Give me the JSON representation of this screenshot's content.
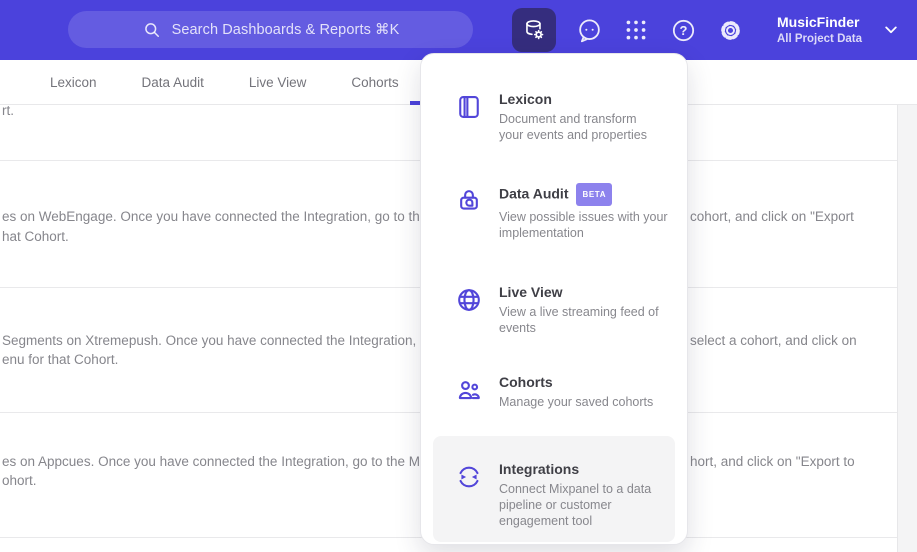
{
  "topbar": {
    "search_placeholder": "Search Dashboards & Reports ⌘K",
    "project_name": "MusicFinder",
    "project_scope": "All Project Data",
    "colors": {
      "bar": "#4b42dc",
      "active_tile": "#352d7e",
      "accent": "#4b42dc",
      "badge": "#8d82ed"
    }
  },
  "nav": {
    "tabs": [
      {
        "label": "Lexicon"
      },
      {
        "label": "Data Audit"
      },
      {
        "label": "Live View"
      },
      {
        "label": "Cohorts"
      }
    ]
  },
  "dropdown": {
    "items": [
      {
        "title": "Lexicon",
        "description": "Document and transform\nyour events and properties"
      },
      {
        "title": "Data Audit",
        "badge": "BETA",
        "description": "View possible issues with your\nimplementation"
      },
      {
        "title": "Live View",
        "description": "View a live streaming feed of\nevents"
      },
      {
        "title": "Cohorts",
        "description": "Manage your saved cohorts"
      },
      {
        "title": "Integrations",
        "description": "Connect Mixpanel to a data\npipeline or customer\nengagement tool"
      }
    ]
  },
  "content": {
    "rows": [
      {
        "line1_left": "rt."
      },
      {
        "line1_left": "es on WebEngage. Once you have connected the Integration, go to the",
        "line1_right": "cohort, and click on \"Export",
        "line2_left": "hat Cohort."
      },
      {
        "line1_left": "Segments on Xtremepush. Once you have connected the Integration,",
        "line1_right": "select a cohort, and click on",
        "line2_left": "enu for that Cohort."
      },
      {
        "line1_left": "es on Appcues. Once you have connected the Integration, go to the M",
        "line1_right": "hort, and click on \"Export to",
        "line2_left": "ohort."
      }
    ]
  }
}
